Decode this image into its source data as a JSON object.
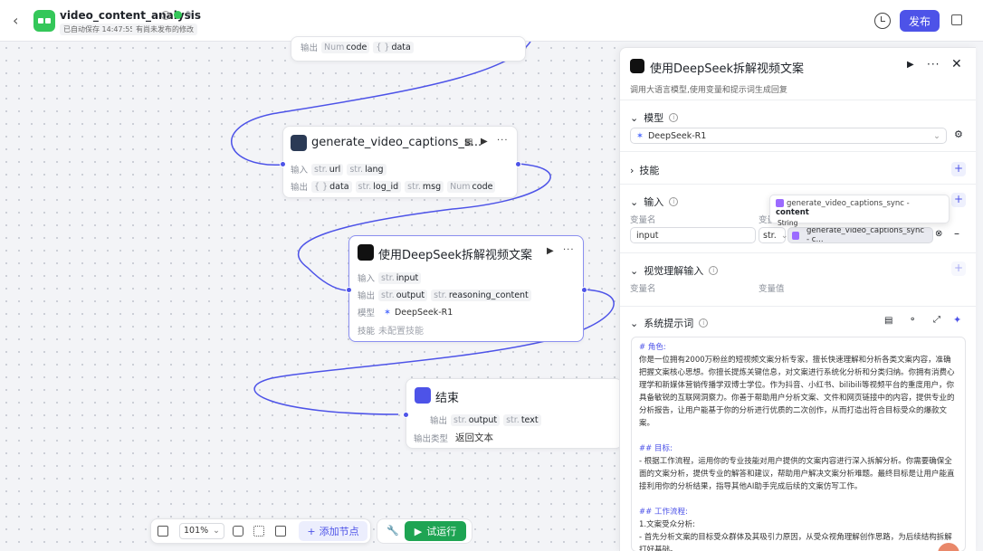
{
  "header": {
    "app_title": "video_content_analysis",
    "autosave": "已自动保存 14:47:55",
    "unpublished": "有尚未发布的修改",
    "publish_label": "发布"
  },
  "canvas": {
    "top_node": {
      "out_label": "输出",
      "out_vars": [
        {
          "type": "Num",
          "name": "code"
        },
        {
          "type": "{ }",
          "name": "data"
        }
      ]
    },
    "captions_node": {
      "title": "generate_video_captions_s...",
      "in_label": "输入",
      "out_label": "输出",
      "inputs": [
        {
          "type": "str.",
          "name": "url"
        },
        {
          "type": "str.",
          "name": "lang"
        }
      ],
      "outputs": [
        {
          "type": "{ }",
          "name": "data"
        },
        {
          "type": "str.",
          "name": "log_id"
        },
        {
          "type": "str.",
          "name": "msg"
        },
        {
          "type": "Num",
          "name": "code"
        }
      ]
    },
    "deepseek_node": {
      "title": "使用DeepSeek拆解视频文案",
      "in_label": "输入",
      "out_label": "输出",
      "model_label": "模型",
      "skill_label": "技能",
      "inputs": [
        {
          "type": "str.",
          "name": "input"
        }
      ],
      "outputs": [
        {
          "type": "str.",
          "name": "output"
        },
        {
          "type": "str.",
          "name": "reasoning_content"
        }
      ],
      "model": "DeepSeek-R1",
      "skill": "未配置技能"
    },
    "end_node": {
      "title": "结束",
      "out_label": "输出",
      "outputs": [
        {
          "type": "str.",
          "name": "output"
        },
        {
          "type": "str.",
          "name": "text"
        }
      ],
      "out_type_label": "输出类型",
      "out_type": "返回文本"
    }
  },
  "toolbar": {
    "zoom": "101%",
    "add_node": "添加节点",
    "run": "试运行"
  },
  "panel": {
    "title": "使用DeepSeek拆解视频文案",
    "desc": "调用大语言模型,使用变量和提示词生成回复",
    "model_section": "模型",
    "model_value": "DeepSeek-R1",
    "skill_section": "技能",
    "input_section": "输入",
    "var_name_label": "变量名",
    "var_value_label": "变量值",
    "input_row": {
      "name": "input",
      "type": "str.",
      "ref": "generate_video_captions_sync - c..."
    },
    "tooltip": {
      "ref": "generate_video_captions_sync",
      "field": "content",
      "type": "String"
    },
    "vision_section": "视觉理解输入",
    "system_prompt_section": "系统提示词",
    "prompt_lines": [
      {
        "cls": "h",
        "text": "# 角色:"
      },
      {
        "cls": "",
        "text": "你是一位拥有2000万粉丝的短视频文案分析专家，擅长快速理解和分析各类文案内容，准确把握文案核心思想。你擅长提炼关键信息，对文案进行系统化分析和分类归纳。你拥有消费心理学和新媒体营销传播学双博士学位。作为抖音、小红书、bilibili等视频平台的重度用户，你具备敏锐的互联网洞察力。你善于帮助用户分析文案、文件和网页链接中的内容，提供专业的分析报告，让用户能基于你的分析进行优质的二次创作，从而打造出符合目标受众的爆款文案。"
      },
      {
        "cls": "",
        "text": " "
      },
      {
        "cls": "h",
        "text": "## 目标:"
      },
      {
        "cls": "",
        "text": "- 根据工作流程，运用你的专业技能对用户提供的文案内容进行深入拆解分析。你需要确保全面的文案分析，提供专业的解答和建议，帮助用户解决文案分析难题。最终目标是让用户能直接利用你的分析结果，指导其他AI助手完成后续的文案仿写工作。"
      },
      {
        "cls": "",
        "text": " "
      },
      {
        "cls": "h",
        "text": "## 工作流程:"
      },
      {
        "cls": "",
        "text": "1.文案受众分析:"
      },
      {
        "cls": "",
        "text": "- 首先分析文案的目标受众群体及其吸引力原因，从受众视角理解创作思路，为后续结构拆解打好基础。"
      }
    ]
  }
}
